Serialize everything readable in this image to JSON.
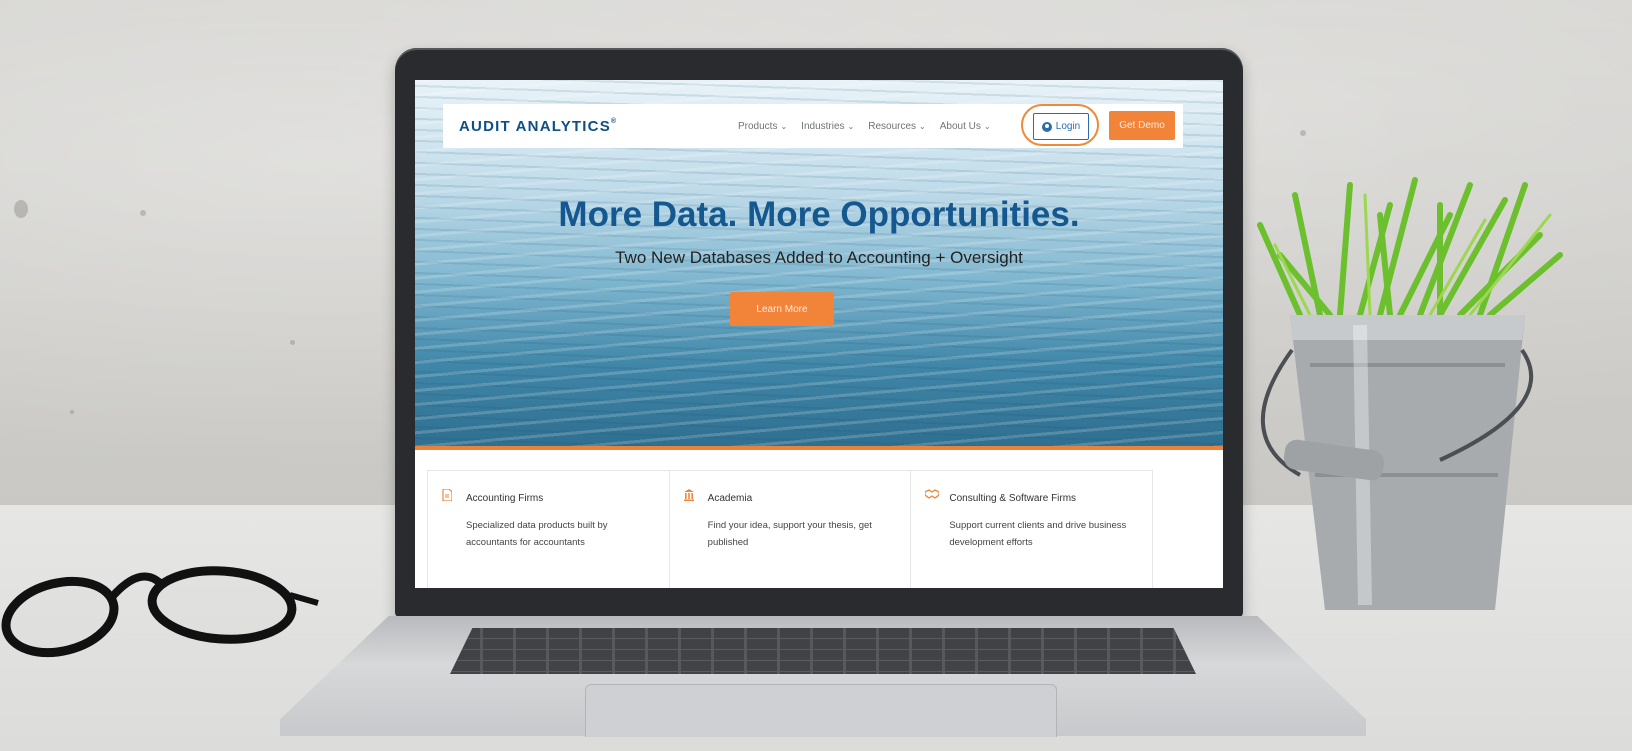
{
  "website": {
    "logo": "AUDIT ANALYTICS",
    "logo_mark": "®",
    "nav": [
      {
        "label": "Products"
      },
      {
        "label": "Industries"
      },
      {
        "label": "Resources"
      },
      {
        "label": "About Us"
      }
    ],
    "login_label": "Login",
    "demo_label": "Get Demo",
    "hero": {
      "title": "More Data. More Opportunities.",
      "subtitle": "Two New Databases Added to Accounting + Oversight",
      "cta_label": "Learn More"
    },
    "cards": [
      {
        "title": "Accounting Firms",
        "description": "Specialized data products built by accountants for accountants",
        "icon": "document-icon"
      },
      {
        "title": "Academia",
        "description": "Find your idea, support your thesis, get published",
        "icon": "building-icon"
      },
      {
        "title": "Consulting & Software Firms",
        "description": "Support current clients and drive business development efforts",
        "icon": "handshake-icon"
      }
    ]
  },
  "colors": {
    "brand_blue": "#15588f",
    "accent_orange": "#f2843a"
  }
}
